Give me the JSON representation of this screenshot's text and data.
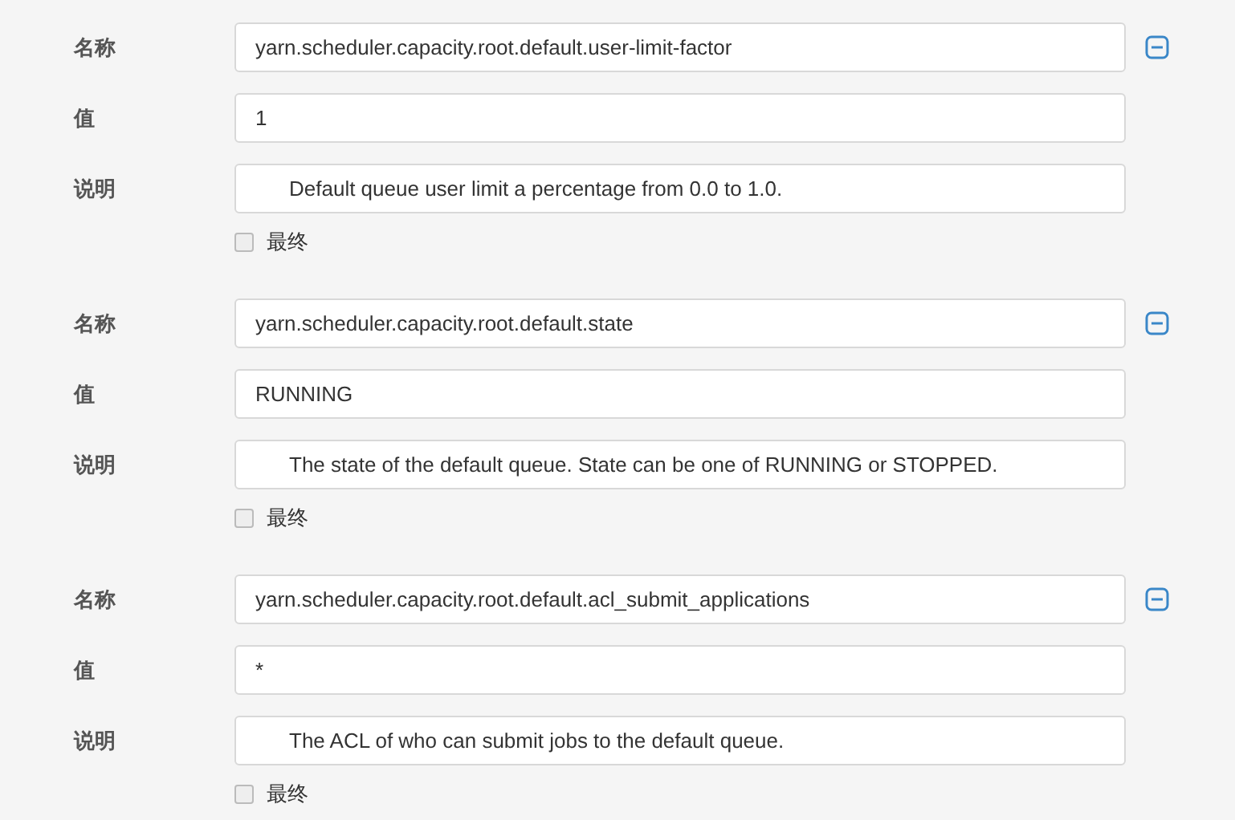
{
  "properties": [
    {
      "fields": [
        {
          "kind": "name",
          "label": "名称",
          "value": "yarn.scheduler.capacity.root.default.user-limit-factor"
        },
        {
          "kind": "value",
          "label": "值",
          "value": "1"
        },
        {
          "kind": "description",
          "label": "说明",
          "value": "Default queue user limit a percentage from 0.0 to 1.0."
        }
      ],
      "final": {
        "label": "最终",
        "checked": false
      }
    },
    {
      "fields": [
        {
          "kind": "name",
          "label": "名称",
          "value": "yarn.scheduler.capacity.root.default.state"
        },
        {
          "kind": "value",
          "label": "值",
          "value": "RUNNING"
        },
        {
          "kind": "description",
          "label": "说明",
          "value": "The state of the default queue. State can be one of RUNNING or STOPPED."
        }
      ],
      "final": {
        "label": "最终",
        "checked": false
      }
    },
    {
      "fields": [
        {
          "kind": "name",
          "label": "名称",
          "value": "yarn.scheduler.capacity.root.default.acl_submit_applications"
        },
        {
          "kind": "value",
          "label": "值",
          "value": "*"
        },
        {
          "kind": "description",
          "label": "说明",
          "value": "The ACL of who can submit jobs to the default queue."
        }
      ],
      "final": {
        "label": "最终",
        "checked": false
      }
    }
  ]
}
